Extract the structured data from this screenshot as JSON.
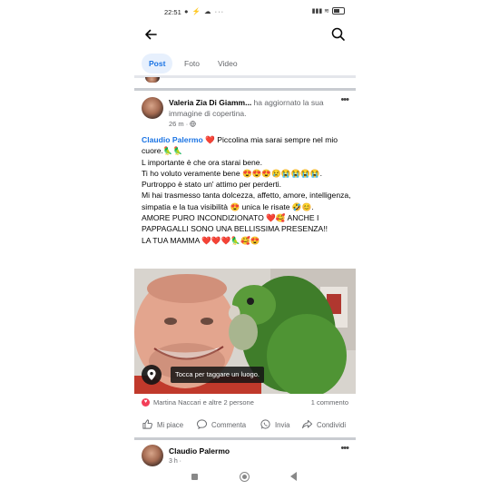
{
  "status_bar": {
    "time": "22:51",
    "left_icons": "● ⚡ ☁ ···",
    "right_icons": "▮▮▮ ≋"
  },
  "header": {
    "back_icon": "back-arrow-icon",
    "search_icon": "search-icon"
  },
  "tabs": [
    {
      "label": "Post",
      "active": true
    },
    {
      "label": "Foto",
      "active": false
    },
    {
      "label": "Video",
      "active": false
    }
  ],
  "post": {
    "author": "Valeria Zia Di Giamm...",
    "action": " ha aggiornato la sua immagine di copertina.",
    "time": "26 m · ",
    "globe_icon": "globe-icon",
    "more": "•••",
    "mention": "Claudio Palermo",
    "text": " ❤️ Piccolina mia sarai sempre nel mio cuore.🦜🦜\nL importante è che ora starai bene.\nTi ho voluto veramente bene 😍😍😍😢😭😭😭😭.\nPurtroppo è stato un' attimo per perderti.\nMi hai trasmesso tanta dolcezza, affetto, amore, intelligenza, simpatia e la tua visibilità 😍 unica le risate 🤣😊.\nAMORE PURO INCONDIZIONATO ❤️🥰 ANCHE I PAPPAGALLI SONO UNA BELLISSIMA PRESENZA!!\nLA TUA MAMMA ❤️❤️❤️🦜🥰😍",
    "photo_tag": "Tocca per taggare un luogo.",
    "reactions_text": "Martina Naccari e altre 2 persone",
    "comments_count": "1 commento",
    "actions": {
      "like": "Mi piace",
      "comment": "Commenta",
      "send": "Invia",
      "share": "Condividi"
    }
  },
  "next_post": {
    "author": "Claudio Palermo",
    "meta": "3 h · ",
    "more": "•••"
  },
  "colors": {
    "accent": "#1b74e4",
    "tab_active_bg": "#e7f0fd",
    "secondary_text": "#65676b",
    "love": "#f33e58"
  }
}
